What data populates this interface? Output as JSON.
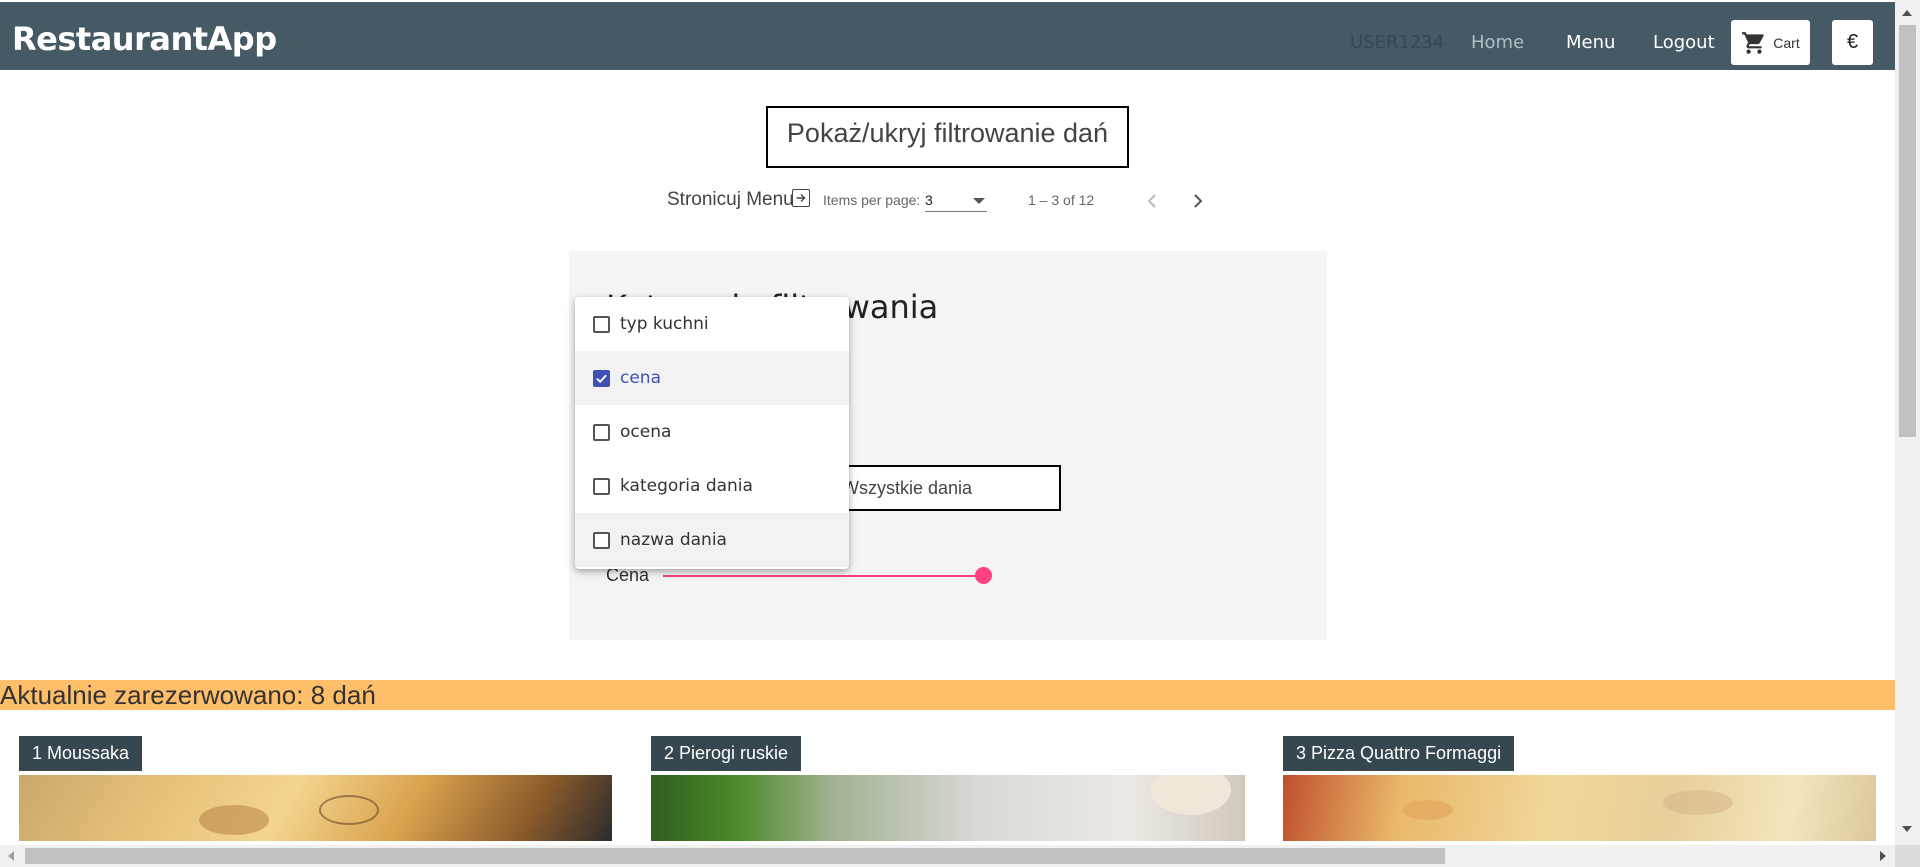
{
  "app": {
    "brand": "RestaurantApp"
  },
  "nav": {
    "user": "USER1234",
    "home": "Home",
    "menu": "Menu",
    "logout": "Logout",
    "cart": "Cart",
    "currency": "€"
  },
  "filter_toggle": {
    "label": "Pokaż/ukryj filtrowanie dań"
  },
  "paginator": {
    "label": "Stronicuj Menu",
    "items_per_page_label": "Items per page:",
    "items_per_page_value": "3",
    "range": "1 – 3 of 12"
  },
  "filter_panel": {
    "title": "Kategorie filtrowania",
    "category_select_value": "Wszystkie dania",
    "price_label": "Cena",
    "price_slider_fraction": 1.0
  },
  "dropdown": {
    "items": [
      {
        "label": "typ kuchni",
        "checked": false
      },
      {
        "label": "cena",
        "checked": true
      },
      {
        "label": "ocena",
        "checked": false
      },
      {
        "label": "kategoria dania",
        "checked": false
      },
      {
        "label": "nazwa dania",
        "checked": false
      }
    ]
  },
  "reservation": {
    "text": "Aktualnie zarezerwowano: 8 dań"
  },
  "cards": [
    {
      "title": "1 Moussaka"
    },
    {
      "title": "2 Pierogi ruskie"
    },
    {
      "title": "3 Pizza Quattro Formaggi"
    }
  ],
  "colors": {
    "navbar": "#455a64",
    "accent": "#3f51b5",
    "slider": "#ff4081",
    "banner": "#ffbe69",
    "card_tag": "#37474f"
  }
}
